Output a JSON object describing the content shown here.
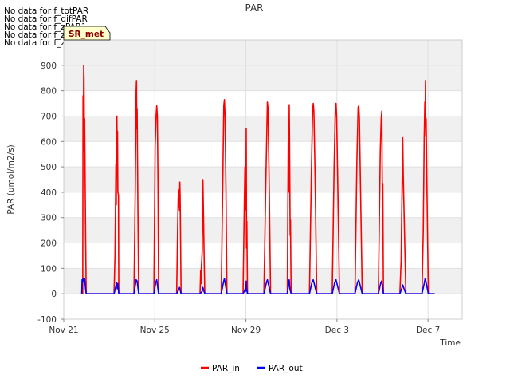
{
  "no_data_messages": [
    "No data for f_totPAR",
    "No data for f_difPAR",
    "No data for f_zPAR1",
    "No data for f_zPAR2",
    "No data for f_zPAR3"
  ],
  "site_badge": "SR_met",
  "colors": {
    "PAR_in": "#ff0000",
    "PAR_out": "#0000ff",
    "band": "#f0f0f0",
    "badge_fill": "#ffffcc"
  },
  "chart_data": {
    "type": "line",
    "title": "PAR",
    "xlabel": "Time",
    "ylabel": "PAR (umol/m2/s)",
    "xlim": [
      "2021-11-21",
      "2021-12-08 12:00"
    ],
    "ylim": [
      -100,
      1000
    ],
    "yticks": [
      -100,
      0,
      100,
      200,
      300,
      400,
      500,
      600,
      700,
      800,
      900
    ],
    "xticks": [
      {
        "date": "2021-11-21",
        "label": "Nov 21"
      },
      {
        "date": "2021-11-25",
        "label": "Nov 25"
      },
      {
        "date": "2021-11-29",
        "label": "Nov 29"
      },
      {
        "date": "2021-12-03",
        "label": "Dec 3"
      },
      {
        "date": "2021-12-07",
        "label": "Dec 7"
      }
    ],
    "grid": true,
    "legend_position": "bottom-center",
    "series": [
      {
        "name": "PAR_in",
        "color": "#ff0000",
        "points": [
          [
            "2021-11-21 20:00",
            0
          ],
          [
            "2021-11-21 20:20",
            780
          ],
          [
            "2021-11-21 20:40",
            560
          ],
          [
            "2021-11-21 21:00",
            900
          ],
          [
            "2021-11-21 21:20",
            850
          ],
          [
            "2021-11-21 21:40",
            650
          ],
          [
            "2021-11-21 22:00",
            690
          ],
          [
            "2021-11-21 23:00",
            250
          ],
          [
            "2021-11-21 23:40",
            0
          ],
          [
            "2021-11-23 05:00",
            0
          ],
          [
            "2021-11-23 06:00",
            150
          ],
          [
            "2021-11-23 07:00",
            510
          ],
          [
            "2021-11-23 07:20",
            350
          ],
          [
            "2021-11-23 08:00",
            700
          ],
          [
            "2021-11-23 08:20",
            530
          ],
          [
            "2021-11-23 08:40",
            640
          ],
          [
            "2021-11-23 09:00",
            400
          ],
          [
            "2021-11-23 09:40",
            390
          ],
          [
            "2021-11-23 10:00",
            0
          ],
          [
            "2021-11-24 02:00",
            0
          ],
          [
            "2021-11-24 03:20",
            400
          ],
          [
            "2021-11-24 04:20",
            800
          ],
          [
            "2021-11-24 04:40",
            840
          ],
          [
            "2021-11-24 05:00",
            650
          ],
          [
            "2021-11-24 05:20",
            730
          ],
          [
            "2021-11-24 06:00",
            400
          ],
          [
            "2021-11-24 07:00",
            0
          ],
          [
            "2021-11-24 23:00",
            0
          ],
          [
            "2021-11-25 00:20",
            580
          ],
          [
            "2021-11-25 01:20",
            700
          ],
          [
            "2021-11-25 02:00",
            740
          ],
          [
            "2021-11-25 02:40",
            700
          ],
          [
            "2021-11-25 03:20",
            450
          ],
          [
            "2021-11-25 04:00",
            0
          ],
          [
            "2021-11-25 23:00",
            0
          ],
          [
            "2021-11-26 00:00",
            250
          ],
          [
            "2021-11-26 00:40",
            380
          ],
          [
            "2021-11-26 01:00",
            340
          ],
          [
            "2021-11-26 01:40",
            410
          ],
          [
            "2021-11-26 02:00",
            330
          ],
          [
            "2021-11-26 02:20",
            440
          ],
          [
            "2021-11-26 02:40",
            380
          ],
          [
            "2021-11-26 03:00",
            260
          ],
          [
            "2021-11-26 03:40",
            0
          ],
          [
            "2021-11-26 23:40",
            0
          ],
          [
            "2021-11-27 00:20",
            90
          ],
          [
            "2021-11-27 00:40",
            40
          ],
          [
            "2021-11-27 01:00",
            100
          ],
          [
            "2021-11-27 02:00",
            170
          ],
          [
            "2021-11-27 02:40",
            450
          ],
          [
            "2021-11-27 03:20",
            300
          ],
          [
            "2021-11-27 04:00",
            140
          ],
          [
            "2021-11-27 04:40",
            0
          ],
          [
            "2021-11-27 22:00",
            0
          ],
          [
            "2021-11-27 23:40",
            450
          ],
          [
            "2021-11-28 00:40",
            740
          ],
          [
            "2021-11-28 01:20",
            765
          ],
          [
            "2021-11-28 02:00",
            700
          ],
          [
            "2021-11-28 03:00",
            400
          ],
          [
            "2021-11-28 04:00",
            0
          ],
          [
            "2021-11-28 21:00",
            0
          ],
          [
            "2021-11-28 22:20",
            350
          ],
          [
            "2021-11-28 23:00",
            500
          ],
          [
            "2021-11-28 23:20",
            330
          ],
          [
            "2021-11-28 23:40",
            490
          ],
          [
            "2021-11-29 00:00",
            380
          ],
          [
            "2021-11-29 00:20",
            650
          ],
          [
            "2021-11-29 00:40",
            180
          ],
          [
            "2021-11-29 01:00",
            285
          ],
          [
            "2021-11-29 01:40",
            0
          ],
          [
            "2021-11-29 19:00",
            0
          ],
          [
            "2021-11-29 21:00",
            440
          ],
          [
            "2021-11-29 22:00",
            630
          ],
          [
            "2021-11-29 22:40",
            755
          ],
          [
            "2021-11-29 23:20",
            730
          ],
          [
            "2021-11-30 00:40",
            400
          ],
          [
            "2021-11-30 02:00",
            0
          ],
          [
            "2021-11-30 19:40",
            0
          ],
          [
            "2021-11-30 20:40",
            600
          ],
          [
            "2021-11-30 21:00",
            400
          ],
          [
            "2021-11-30 21:40",
            745
          ],
          [
            "2021-11-30 22:00",
            600
          ],
          [
            "2021-11-30 22:40",
            230
          ],
          [
            "2021-11-30 23:00",
            290
          ],
          [
            "2021-11-30 23:40",
            0
          ],
          [
            "2021-12-01 19:00",
            0
          ],
          [
            "2021-12-01 21:00",
            470
          ],
          [
            "2021-12-01 22:20",
            720
          ],
          [
            "2021-12-01 23:00",
            750
          ],
          [
            "2021-12-01 23:40",
            720
          ],
          [
            "2021-12-02 01:00",
            450
          ],
          [
            "2021-12-02 02:40",
            0
          ],
          [
            "2021-12-02 19:00",
            0
          ],
          [
            "2021-12-02 21:00",
            500
          ],
          [
            "2021-12-02 22:20",
            740
          ],
          [
            "2021-12-02 23:00",
            750
          ],
          [
            "2021-12-02 23:40",
            700
          ],
          [
            "2021-12-03 01:00",
            400
          ],
          [
            "2021-12-03 02:40",
            0
          ],
          [
            "2021-12-03 19:00",
            0
          ],
          [
            "2021-12-03 21:00",
            520
          ],
          [
            "2021-12-03 22:20",
            735
          ],
          [
            "2021-12-03 23:00",
            740
          ],
          [
            "2021-12-03 23:40",
            690
          ],
          [
            "2021-12-04 01:00",
            380
          ],
          [
            "2021-12-04 02:40",
            0
          ],
          [
            "2021-12-04 19:40",
            0
          ],
          [
            "2021-12-04 21:40",
            560
          ],
          [
            "2021-12-04 22:40",
            690
          ],
          [
            "2021-12-04 23:20",
            720
          ],
          [
            "2021-12-04 23:40",
            500
          ],
          [
            "2021-12-05 00:00",
            340
          ],
          [
            "2021-12-05 00:20",
            435
          ],
          [
            "2021-12-05 01:00",
            0
          ],
          [
            "2021-12-05 18:20",
            0
          ],
          [
            "2021-12-05 19:40",
            130
          ],
          [
            "2021-12-05 20:40",
            420
          ],
          [
            "2021-12-05 21:20",
            615
          ],
          [
            "2021-12-05 22:00",
            450
          ],
          [
            "2021-12-05 23:00",
            280
          ],
          [
            "2021-12-06 00:40",
            0
          ],
          [
            "2021-12-06 17:40",
            0
          ],
          [
            "2021-12-06 19:00",
            250
          ],
          [
            "2021-12-06 20:00",
            620
          ],
          [
            "2021-12-06 20:40",
            755
          ],
          [
            "2021-12-06 21:00",
            660
          ],
          [
            "2021-12-06 21:20",
            840
          ],
          [
            "2021-12-06 21:40",
            620
          ],
          [
            "2021-12-06 22:00",
            690
          ],
          [
            "2021-12-06 23:00",
            380
          ],
          [
            "2021-12-07 00:20",
            0
          ],
          [
            "2021-12-07 07:00",
            0
          ]
        ]
      },
      {
        "name": "PAR_out",
        "color": "#0000ff",
        "points": [
          [
            "2021-11-21 19:00",
            0
          ],
          [
            "2021-11-21 19:20",
            55
          ],
          [
            "2021-11-21 20:00",
            45
          ],
          [
            "2021-11-21 20:40",
            60
          ],
          [
            "2021-11-21 21:20",
            50
          ],
          [
            "2021-11-21 22:00",
            60
          ],
          [
            "2021-11-21 23:00",
            20
          ],
          [
            "2021-11-21 23:40",
            0
          ],
          [
            "2021-11-23 05:00",
            0
          ],
          [
            "2021-11-23 07:00",
            30
          ],
          [
            "2021-11-23 07:40",
            45
          ],
          [
            "2021-11-23 08:20",
            20
          ],
          [
            "2021-11-23 09:00",
            40
          ],
          [
            "2021-11-23 10:00",
            0
          ],
          [
            "2021-11-24 02:00",
            0
          ],
          [
            "2021-11-24 03:40",
            40
          ],
          [
            "2021-11-24 04:20",
            55
          ],
          [
            "2021-11-24 05:20",
            50
          ],
          [
            "2021-11-24 07:00",
            0
          ],
          [
            "2021-11-24 23:00",
            0
          ],
          [
            "2021-11-25 01:00",
            45
          ],
          [
            "2021-11-25 02:00",
            55
          ],
          [
            "2021-11-25 04:00",
            0
          ],
          [
            "2021-11-25 23:00",
            0
          ],
          [
            "2021-11-26 01:00",
            15
          ],
          [
            "2021-11-26 02:00",
            25
          ],
          [
            "2021-11-26 03:40",
            0
          ],
          [
            "2021-11-26 23:40",
            0
          ],
          [
            "2021-11-27 02:00",
            10
          ],
          [
            "2021-11-27 02:40",
            25
          ],
          [
            "2021-11-27 04:40",
            0
          ],
          [
            "2021-11-27 22:00",
            0
          ],
          [
            "2021-11-28 00:20",
            45
          ],
          [
            "2021-11-28 01:20",
            60
          ],
          [
            "2021-11-28 04:00",
            0
          ],
          [
            "2021-11-28 21:00",
            0
          ],
          [
            "2021-11-28 23:00",
            15
          ],
          [
            "2021-11-28 23:40",
            30
          ],
          [
            "2021-11-29 00:00",
            10
          ],
          [
            "2021-11-29 00:20",
            50
          ],
          [
            "2021-11-29 00:40",
            20
          ],
          [
            "2021-11-29 01:40",
            0
          ],
          [
            "2021-11-29 19:00",
            0
          ],
          [
            "2021-11-29 21:40",
            45
          ],
          [
            "2021-11-29 22:40",
            55
          ],
          [
            "2021-11-30 02:00",
            0
          ],
          [
            "2021-11-30 19:40",
            0
          ],
          [
            "2021-11-30 21:00",
            40
          ],
          [
            "2021-11-30 21:40",
            55
          ],
          [
            "2021-11-30 22:20",
            20
          ],
          [
            "2021-11-30 23:40",
            0
          ],
          [
            "2021-12-01 19:00",
            0
          ],
          [
            "2021-12-01 21:40",
            45
          ],
          [
            "2021-12-01 23:00",
            55
          ],
          [
            "2021-12-02 02:40",
            0
          ],
          [
            "2021-12-02 19:00",
            0
          ],
          [
            "2021-12-02 21:40",
            45
          ],
          [
            "2021-12-02 23:00",
            55
          ],
          [
            "2021-12-03 02:40",
            0
          ],
          [
            "2021-12-03 19:00",
            0
          ],
          [
            "2021-12-03 21:40",
            45
          ],
          [
            "2021-12-03 23:00",
            55
          ],
          [
            "2021-12-04 02:40",
            0
          ],
          [
            "2021-12-04 19:40",
            0
          ],
          [
            "2021-12-04 22:00",
            40
          ],
          [
            "2021-12-04 23:00",
            50
          ],
          [
            "2021-12-05 00:00",
            30
          ],
          [
            "2021-12-05 01:00",
            0
          ],
          [
            "2021-12-05 18:20",
            0
          ],
          [
            "2021-12-05 20:40",
            25
          ],
          [
            "2021-12-05 21:20",
            35
          ],
          [
            "2021-12-06 00:40",
            0
          ],
          [
            "2021-12-06 17:40",
            0
          ],
          [
            "2021-12-06 20:00",
            40
          ],
          [
            "2021-12-06 21:00",
            60
          ],
          [
            "2021-12-06 22:00",
            45
          ],
          [
            "2021-12-07 00:20",
            0
          ],
          [
            "2021-12-07 07:00",
            0
          ]
        ]
      }
    ]
  }
}
